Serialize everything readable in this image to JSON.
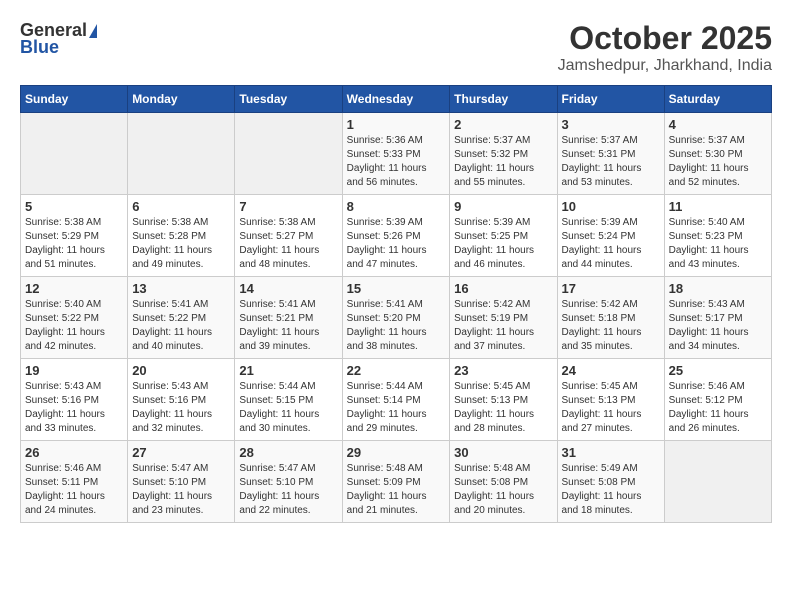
{
  "logo": {
    "general": "General",
    "blue": "Blue"
  },
  "title": "October 2025",
  "location": "Jamshedpur, Jharkhand, India",
  "weekdays": [
    "Sunday",
    "Monday",
    "Tuesday",
    "Wednesday",
    "Thursday",
    "Friday",
    "Saturday"
  ],
  "weeks": [
    [
      {
        "day": "",
        "sunrise": "",
        "sunset": "",
        "daylight": ""
      },
      {
        "day": "",
        "sunrise": "",
        "sunset": "",
        "daylight": ""
      },
      {
        "day": "",
        "sunrise": "",
        "sunset": "",
        "daylight": ""
      },
      {
        "day": "1",
        "sunrise": "Sunrise: 5:36 AM",
        "sunset": "Sunset: 5:33 PM",
        "daylight": "Daylight: 11 hours and 56 minutes."
      },
      {
        "day": "2",
        "sunrise": "Sunrise: 5:37 AM",
        "sunset": "Sunset: 5:32 PM",
        "daylight": "Daylight: 11 hours and 55 minutes."
      },
      {
        "day": "3",
        "sunrise": "Sunrise: 5:37 AM",
        "sunset": "Sunset: 5:31 PM",
        "daylight": "Daylight: 11 hours and 53 minutes."
      },
      {
        "day": "4",
        "sunrise": "Sunrise: 5:37 AM",
        "sunset": "Sunset: 5:30 PM",
        "daylight": "Daylight: 11 hours and 52 minutes."
      }
    ],
    [
      {
        "day": "5",
        "sunrise": "Sunrise: 5:38 AM",
        "sunset": "Sunset: 5:29 PM",
        "daylight": "Daylight: 11 hours and 51 minutes."
      },
      {
        "day": "6",
        "sunrise": "Sunrise: 5:38 AM",
        "sunset": "Sunset: 5:28 PM",
        "daylight": "Daylight: 11 hours and 49 minutes."
      },
      {
        "day": "7",
        "sunrise": "Sunrise: 5:38 AM",
        "sunset": "Sunset: 5:27 PM",
        "daylight": "Daylight: 11 hours and 48 minutes."
      },
      {
        "day": "8",
        "sunrise": "Sunrise: 5:39 AM",
        "sunset": "Sunset: 5:26 PM",
        "daylight": "Daylight: 11 hours and 47 minutes."
      },
      {
        "day": "9",
        "sunrise": "Sunrise: 5:39 AM",
        "sunset": "Sunset: 5:25 PM",
        "daylight": "Daylight: 11 hours and 46 minutes."
      },
      {
        "day": "10",
        "sunrise": "Sunrise: 5:39 AM",
        "sunset": "Sunset: 5:24 PM",
        "daylight": "Daylight: 11 hours and 44 minutes."
      },
      {
        "day": "11",
        "sunrise": "Sunrise: 5:40 AM",
        "sunset": "Sunset: 5:23 PM",
        "daylight": "Daylight: 11 hours and 43 minutes."
      }
    ],
    [
      {
        "day": "12",
        "sunrise": "Sunrise: 5:40 AM",
        "sunset": "Sunset: 5:22 PM",
        "daylight": "Daylight: 11 hours and 42 minutes."
      },
      {
        "day": "13",
        "sunrise": "Sunrise: 5:41 AM",
        "sunset": "Sunset: 5:22 PM",
        "daylight": "Daylight: 11 hours and 40 minutes."
      },
      {
        "day": "14",
        "sunrise": "Sunrise: 5:41 AM",
        "sunset": "Sunset: 5:21 PM",
        "daylight": "Daylight: 11 hours and 39 minutes."
      },
      {
        "day": "15",
        "sunrise": "Sunrise: 5:41 AM",
        "sunset": "Sunset: 5:20 PM",
        "daylight": "Daylight: 11 hours and 38 minutes."
      },
      {
        "day": "16",
        "sunrise": "Sunrise: 5:42 AM",
        "sunset": "Sunset: 5:19 PM",
        "daylight": "Daylight: 11 hours and 37 minutes."
      },
      {
        "day": "17",
        "sunrise": "Sunrise: 5:42 AM",
        "sunset": "Sunset: 5:18 PM",
        "daylight": "Daylight: 11 hours and 35 minutes."
      },
      {
        "day": "18",
        "sunrise": "Sunrise: 5:43 AM",
        "sunset": "Sunset: 5:17 PM",
        "daylight": "Daylight: 11 hours and 34 minutes."
      }
    ],
    [
      {
        "day": "19",
        "sunrise": "Sunrise: 5:43 AM",
        "sunset": "Sunset: 5:16 PM",
        "daylight": "Daylight: 11 hours and 33 minutes."
      },
      {
        "day": "20",
        "sunrise": "Sunrise: 5:43 AM",
        "sunset": "Sunset: 5:16 PM",
        "daylight": "Daylight: 11 hours and 32 minutes."
      },
      {
        "day": "21",
        "sunrise": "Sunrise: 5:44 AM",
        "sunset": "Sunset: 5:15 PM",
        "daylight": "Daylight: 11 hours and 30 minutes."
      },
      {
        "day": "22",
        "sunrise": "Sunrise: 5:44 AM",
        "sunset": "Sunset: 5:14 PM",
        "daylight": "Daylight: 11 hours and 29 minutes."
      },
      {
        "day": "23",
        "sunrise": "Sunrise: 5:45 AM",
        "sunset": "Sunset: 5:13 PM",
        "daylight": "Daylight: 11 hours and 28 minutes."
      },
      {
        "day": "24",
        "sunrise": "Sunrise: 5:45 AM",
        "sunset": "Sunset: 5:13 PM",
        "daylight": "Daylight: 11 hours and 27 minutes."
      },
      {
        "day": "25",
        "sunrise": "Sunrise: 5:46 AM",
        "sunset": "Sunset: 5:12 PM",
        "daylight": "Daylight: 11 hours and 26 minutes."
      }
    ],
    [
      {
        "day": "26",
        "sunrise": "Sunrise: 5:46 AM",
        "sunset": "Sunset: 5:11 PM",
        "daylight": "Daylight: 11 hours and 24 minutes."
      },
      {
        "day": "27",
        "sunrise": "Sunrise: 5:47 AM",
        "sunset": "Sunset: 5:10 PM",
        "daylight": "Daylight: 11 hours and 23 minutes."
      },
      {
        "day": "28",
        "sunrise": "Sunrise: 5:47 AM",
        "sunset": "Sunset: 5:10 PM",
        "daylight": "Daylight: 11 hours and 22 minutes."
      },
      {
        "day": "29",
        "sunrise": "Sunrise: 5:48 AM",
        "sunset": "Sunset: 5:09 PM",
        "daylight": "Daylight: 11 hours and 21 minutes."
      },
      {
        "day": "30",
        "sunrise": "Sunrise: 5:48 AM",
        "sunset": "Sunset: 5:08 PM",
        "daylight": "Daylight: 11 hours and 20 minutes."
      },
      {
        "day": "31",
        "sunrise": "Sunrise: 5:49 AM",
        "sunset": "Sunset: 5:08 PM",
        "daylight": "Daylight: 11 hours and 18 minutes."
      },
      {
        "day": "",
        "sunrise": "",
        "sunset": "",
        "daylight": ""
      }
    ]
  ]
}
